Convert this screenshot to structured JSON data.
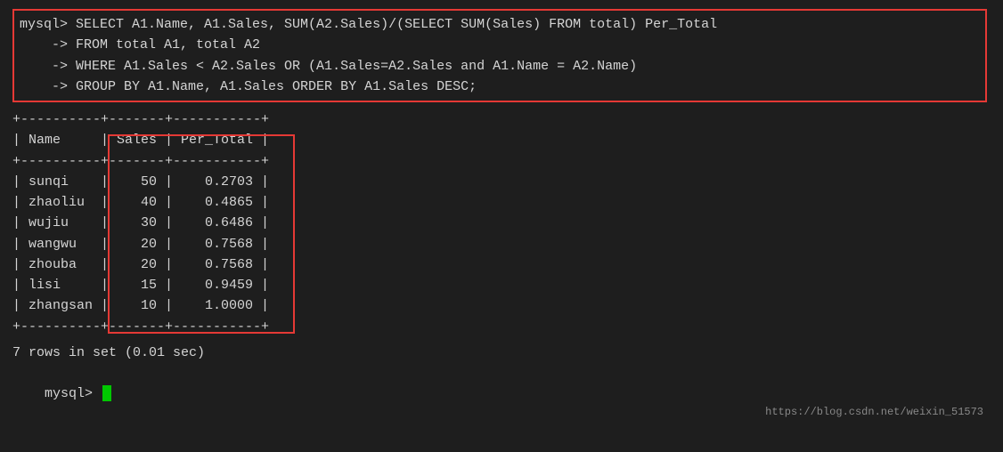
{
  "terminal": {
    "prompt_main": "mysql> ",
    "prompt_cont": "    -> ",
    "query": {
      "line1": "SELECT A1.Name, A1.Sales, SUM(A2.Sales)/(SELECT SUM(Sales) FROM total) Per_Total",
      "line2": "FROM total A1, total A2",
      "line3": "WHERE A1.Sales < A2.Sales OR (A1.Sales=A2.Sales and A1.Name = A2.Name)",
      "line4": "GROUP BY A1.Name, A1.Sales ORDER BY A1.Sales DESC;"
    },
    "separator_top": "+----------+-------+-----------+",
    "header": "| Name     | Sales | Per_Total |",
    "separator_mid": "+----------+-------+-----------+",
    "rows": [
      "| sunqi    |    50 |    0.2703 |",
      "| zhaoliu  |    40 |    0.4865 |",
      "| wujiu    |    30 |    0.6486 |",
      "| wangwu   |    20 |    0.7568 |",
      "| zhouba   |    20 |    0.7568 |",
      "| lisi     |    15 |    0.9459 |",
      "| zhangsan |    10 |    1.0000 |"
    ],
    "separator_bot": "+----------+-------+-----------+",
    "footer": "7 rows in set (0.01 sec)",
    "final_prompt": "mysql> ",
    "watermark": "https://blog.csdn.net/weixin_51573"
  }
}
